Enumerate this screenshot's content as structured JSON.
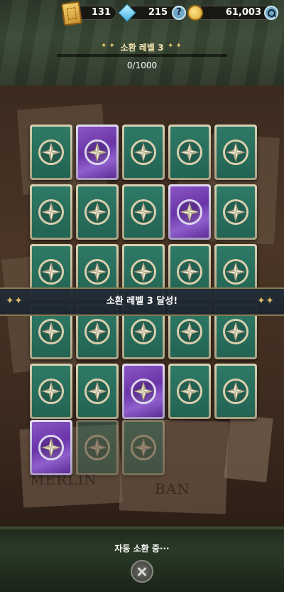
{
  "hud": {
    "tickets": "131",
    "gems": "215",
    "coins": "61,003"
  },
  "summon": {
    "level_label": "소환 레벨 3",
    "progress_text": "0/1000",
    "progress_fraction": 0.0
  },
  "banner": {
    "text": "소환 레벨 3 달성!"
  },
  "board": {
    "name_plates": [
      "MERLIN",
      "BAN"
    ],
    "card_rows": [
      [
        "green",
        "purple",
        "green",
        "green",
        "green"
      ],
      [
        "green",
        "green",
        "green",
        "purple",
        "green"
      ],
      [
        "green",
        "green",
        "green",
        "green",
        "green"
      ],
      [
        "green",
        "green",
        "green",
        "green",
        "green"
      ],
      [
        "green",
        "green",
        "purple",
        "green",
        "green"
      ],
      [
        "purple",
        "green-faded",
        "green-faded"
      ]
    ]
  },
  "footer": {
    "auto_summon_text": "자동 소환 중···"
  },
  "icons": {
    "ticket": "ticket-icon",
    "gem": "gem-icon",
    "help": "help-icon",
    "coin": "coin-icon",
    "search": "search-icon",
    "close": "close-icon",
    "card_emblem": "compass-star-icon"
  },
  "colors": {
    "card_green": "#2e7a66",
    "card_purple": "#7a46b6",
    "accent_gold": "#e8c76a"
  }
}
